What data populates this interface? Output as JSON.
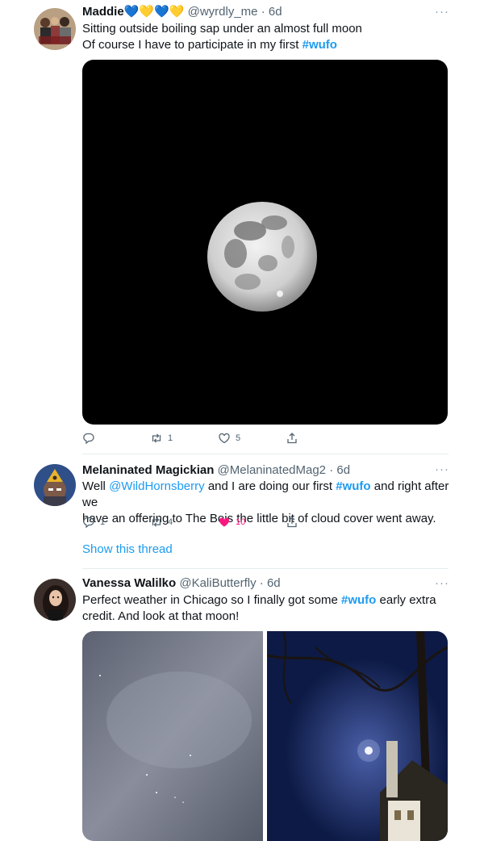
{
  "tweets": [
    {
      "name": "Maddie",
      "emojis": [
        "💙",
        "💛",
        "💙",
        "💛"
      ],
      "handle": "@wyrdly_me",
      "time": "6d",
      "line1": "Sitting outside boiling sap under an almost full moon",
      "line2_pre": "Of course I have to participate in my first ",
      "hashtag": "#wufo",
      "actions": {
        "reply": "",
        "retweet": "1",
        "like": "5"
      }
    },
    {
      "name": "Melaninated Magickian",
      "handle": "@MelaninatedMag2",
      "time": "6d",
      "line1_pre": "Well ",
      "mention": "@WildHornsberry",
      "line1_mid": " and I are doing our first ",
      "hashtag": "#wufo",
      "line1_post": " and right after we",
      "line2": "have an offering to The Bois the little bit of cloud cover went away.",
      "actions": {
        "reply": "1",
        "retweet": "4",
        "like": "10"
      },
      "show_thread": "Show this thread"
    },
    {
      "name": "Vanessa Walilko",
      "handle": "@KaliButterfly",
      "time": "6d",
      "line1_pre": "Perfect weather in Chicago so I finally got some ",
      "hashtag": "#wufo",
      "line1_post": " early extra",
      "line2": "credit.  And look at that moon!"
    }
  ],
  "sep": " · ",
  "more_label": "···",
  "colors": {
    "link": "#1d9bf0",
    "like_active": "#f91880",
    "secondary": "#536471",
    "divider": "#e6ecf0"
  }
}
